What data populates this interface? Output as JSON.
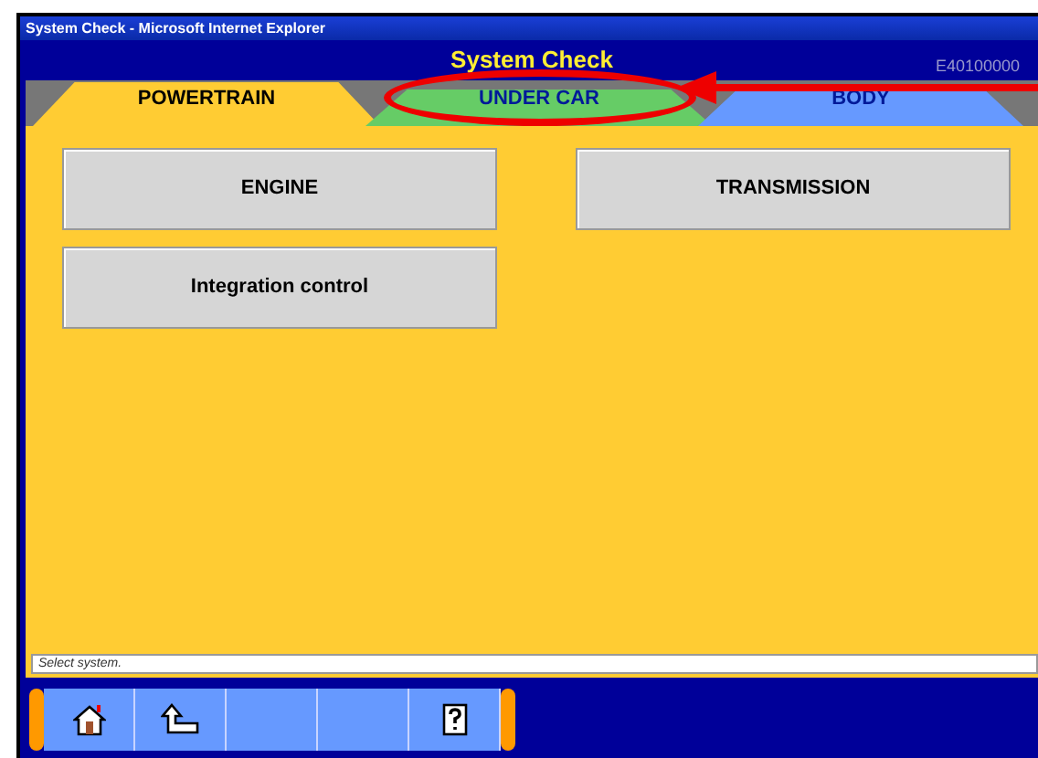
{
  "window": {
    "title": "System Check - Microsoft Internet Explorer"
  },
  "header": {
    "title": "System Check",
    "code": "E40100000"
  },
  "tabs": [
    {
      "label": "POWERTRAIN",
      "selected": true,
      "color": "#ffcc33",
      "circled": false
    },
    {
      "label": "UNDER CAR",
      "selected": false,
      "color": "#66cc66",
      "circled": true
    },
    {
      "label": "BODY",
      "selected": false,
      "color": "#6699ff",
      "circled": false
    }
  ],
  "annotation_arrow": true,
  "systems": [
    {
      "label": "ENGINE"
    },
    {
      "label": "TRANSMISSION"
    },
    {
      "label": "Integration control"
    }
  ],
  "status": {
    "value": "Select system."
  },
  "toolbar": [
    {
      "kind": "home"
    },
    {
      "kind": "back"
    },
    {
      "kind": "empty"
    },
    {
      "kind": "empty"
    },
    {
      "kind": "help"
    }
  ]
}
